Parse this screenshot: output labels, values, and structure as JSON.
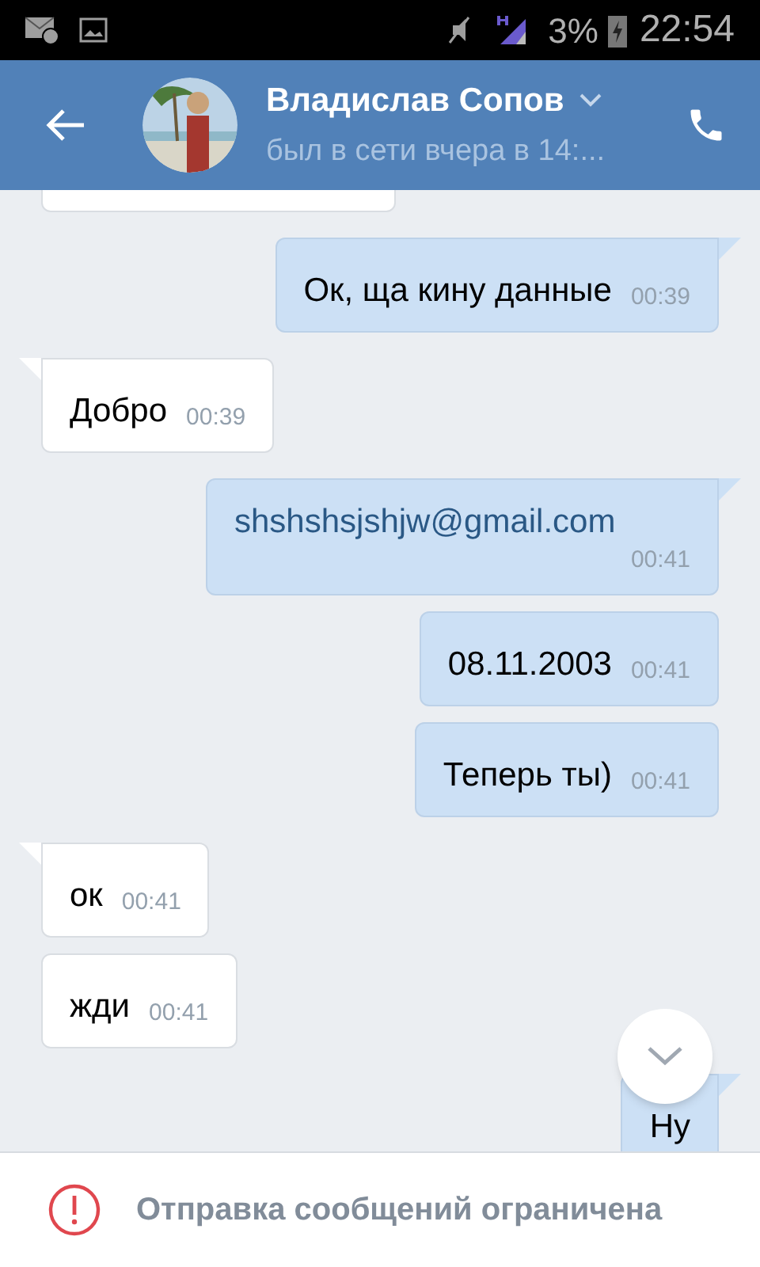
{
  "status_bar": {
    "battery": "3%",
    "time": "22:54"
  },
  "header": {
    "name": "Владислав Сопов",
    "last_seen": "был в сети вчера в 14:..."
  },
  "messages": [
    {
      "kind": "in",
      "tail": false
    },
    {
      "kind": "out",
      "tail": true,
      "link": false,
      "text": "Ок, ща кину данные",
      "time": "00:39"
    },
    {
      "kind": "in",
      "tail": true,
      "link": false,
      "text": "Добро",
      "time": "00:39"
    },
    {
      "kind": "out",
      "tail": true,
      "link": true,
      "text": "shshshsjshjw@gmail.com",
      "time": "00:41"
    },
    {
      "kind": "out",
      "tail": false,
      "link": false,
      "text": "08.11.2003",
      "time": "00:41"
    },
    {
      "kind": "out",
      "tail": false,
      "link": false,
      "text": "Теперь ты)",
      "time": "00:41"
    },
    {
      "kind": "in",
      "tail": true,
      "link": false,
      "text": "ок",
      "time": "00:41"
    },
    {
      "kind": "in",
      "tail": false,
      "link": false,
      "text": "жди",
      "time": "00:41"
    },
    {
      "kind": "out",
      "tail": true,
      "link": false,
      "text": "Ну"
    }
  ],
  "notice": "Отправка сообщений ограничена"
}
